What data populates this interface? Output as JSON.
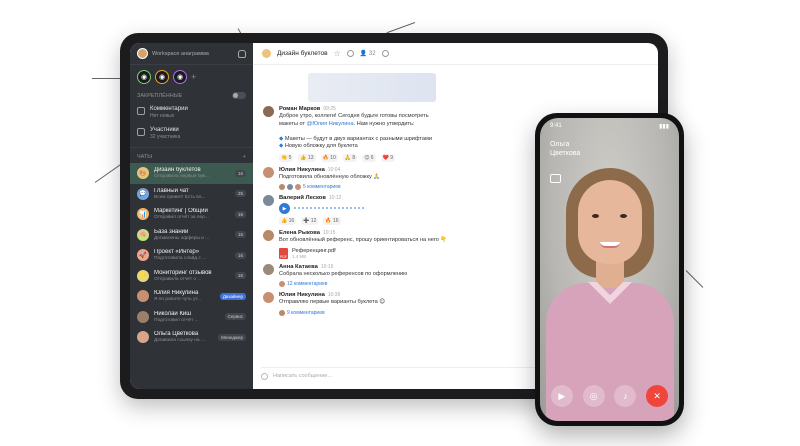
{
  "annotations": {
    "top_left": "",
    "top_right": "",
    "left_upper": "",
    "left_lower": "",
    "bottom": "",
    "right": ""
  },
  "sidebar": {
    "workspace": "Workspace анаграмма",
    "toggle_label": "ЗАКРЕПЛЁННЫЕ",
    "sections": [
      {
        "title": "Комментарии",
        "subtitle": "Нет новых"
      },
      {
        "title": "Участники",
        "subtitle": "32 участника"
      }
    ],
    "chats_header": "ЧАТЫ",
    "chats": [
      {
        "name": "Дизайн буклетов",
        "preview": "Отправила первые бук...",
        "badge": "16",
        "active": true,
        "color": "#e8c47c",
        "emoji": "🎨"
      },
      {
        "name": "Главный чат",
        "preview": "Всем привет! Есть во...",
        "badge": "25",
        "color": "#6fa7e8",
        "emoji": "💬"
      },
      {
        "name": "Маркетинг | Общий",
        "preview": "Отправил отчёт за пер...",
        "badge": "16",
        "color": "#f2b66a",
        "emoji": "📊"
      },
      {
        "name": "База знаний",
        "preview": "Добавлены офферы и ...",
        "badge": "16",
        "color": "#c8e07a",
        "emoji": "🧠"
      },
      {
        "name": "Проект «Интер»",
        "preview": "Подготовила слайд с ...",
        "badge": "16",
        "color": "#f0a38a",
        "emoji": "🚀"
      },
      {
        "name": "Мониторинг отзывов",
        "preview": "Отправила отчёт о ...",
        "badge": "16",
        "color": "#e8d57c",
        "emoji": "⭐"
      },
      {
        "name": "Юлия Никулина",
        "preview": "Я по работе чуть ут...",
        "badge": "Дизайнер",
        "badge_blue": true,
        "color": "#c98f73",
        "emoji": ""
      },
      {
        "name": "Николай Киш",
        "preview": "Подготовил отчёт ...",
        "badge": "Сервис",
        "color": "#9a7f6a",
        "emoji": ""
      },
      {
        "name": "Ольга Цветкова",
        "preview": "Добавила ссылку на ...",
        "badge": "Менеджер",
        "color": "#d9a58a",
        "emoji": ""
      }
    ]
  },
  "main": {
    "channel": "Дизайн буклетов",
    "members": "32",
    "composer_placeholder": "Написать сообщение...",
    "messages": [
      {
        "name": "Роман Марков",
        "time": "09:25",
        "text1": "Доброе утро, коллеги! Сегодня будьте готовы посмотреть",
        "text2a": "макеты от ",
        "mention": "@Юлия Никулина",
        "text2b": ". Нам нужно утвердить:",
        "b1": "Макеты — будут в двух вариантах с разными шрифтами",
        "b2": "Новую обложку для буклета",
        "color": "#8a6a55"
      },
      {
        "name": "Юлия Никулина",
        "time": "10:04",
        "text": "Подготовила обновлённую обложку 🙏",
        "link": "5 комментариев",
        "color": "#c98f73"
      },
      {
        "name": "Валерий Лесков",
        "time": "10:12",
        "color": "#7a8a9a"
      },
      {
        "name": "Елена Рыкова",
        "time": "10:15",
        "text": "Вот обновлённый референс, прошу ориентироваться на него 👇",
        "file": "Референцинг.pdf",
        "file_size": "1,4 MB",
        "color": "#b88a6a"
      },
      {
        "name": "Анна Катаева",
        "time": "10:16",
        "text": "Собрала несколько референсов по оформлению",
        "link": "12 комментариев",
        "color": "#9a8a7a"
      },
      {
        "name": "Юлия Никулина",
        "time": "10:36",
        "text": "Отправляю первые варианты буклета 😊",
        "link": "9 комментариев",
        "color": "#c98f73"
      }
    ],
    "reactions": [
      "👏 5",
      "👍 13",
      "🔥 10",
      "🙏 8",
      "😊 6",
      "❤️ 9"
    ],
    "voice_reactions": [
      "👍 16",
      "➕ 12",
      "🔥 16"
    ]
  },
  "phone": {
    "time": "9:41",
    "caller_first": "Ольга",
    "caller_last": "Цветкова"
  }
}
